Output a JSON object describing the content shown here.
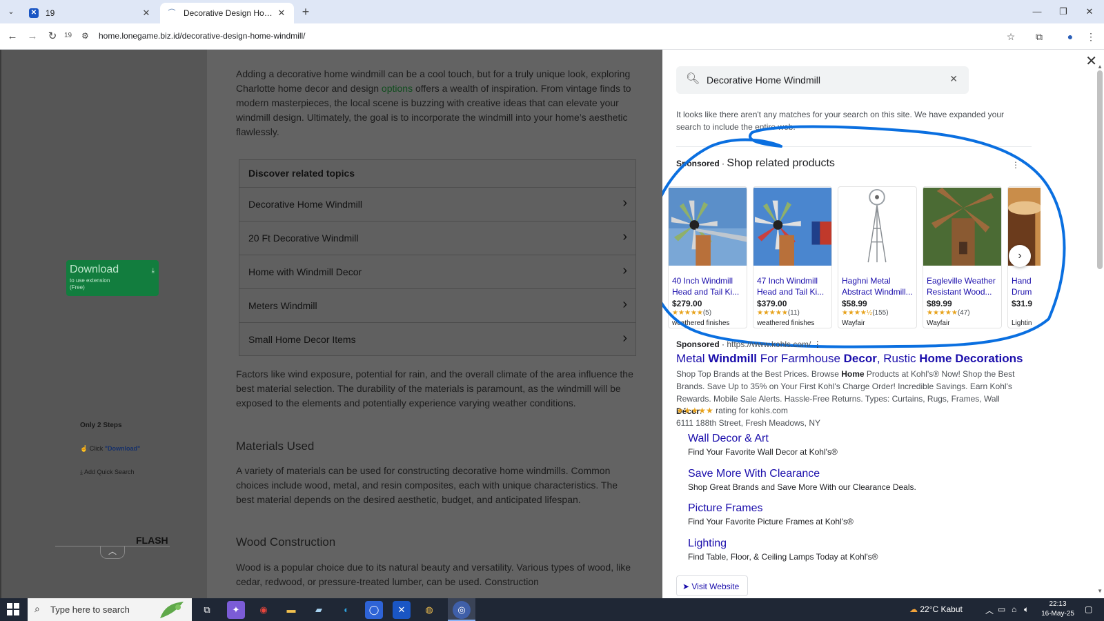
{
  "browser": {
    "tabs": [
      {
        "title": "19",
        "active": false
      },
      {
        "title": "Decorative Design Home Windmill",
        "active": true
      }
    ],
    "nav_count": "19",
    "url": "home.lonegame.biz.id/decorative-design-home-windmill/"
  },
  "sidebar": {
    "download": {
      "label": "Download",
      "sub1": "to use extension",
      "sub2": "(Free)"
    },
    "steps_title": "Only 2 Steps",
    "step1_prefix": "Click ",
    "step1_link": "\"Download\"",
    "step2": "Add Quick Search",
    "flash": "FLASH"
  },
  "article": {
    "intro_before": "Adding a decorative home windmill can be a cool touch, but for a truly unique look, exploring Charlotte home decor and design ",
    "intro_link": "options",
    "intro_after": " offers a wealth of inspiration. From vintage finds to modern masterpieces, the local scene is buzzing with creative ideas that can elevate your windmill design. Ultimately, the goal is to incorporate the windmill into your home’s aesthetic flawlessly.",
    "topics_heading": "Discover related topics",
    "topics": [
      "Decorative Home Windmill",
      "20 Ft Decorative Windmill",
      "Home with Windmill Decor",
      "Meters Windmill",
      "Small Home Decor Items"
    ],
    "para2": "Factors like wind exposure, potential for rain, and the overall climate of the area influence the best material selection. The durability of the materials is paramount, as the windmill will be exposed to the elements and potentially experience varying weather conditions.",
    "h_materials": "Materials Used",
    "para3": "A variety of materials can be used for constructing decorative home windmills. Common choices include wood, metal, and resin composites, each with unique characteristics. The best material depends on the desired aesthetic, budget, and anticipated lifespan.",
    "h_wood": "Wood Construction",
    "para4": "Wood is a popular choice due to its natural beauty and versatility. Various types of wood, like cedar, redwood, or pressure-treated lumber, can be used. Construction"
  },
  "search_panel": {
    "query": "Decorative Home Windmill",
    "no_match": "It looks like there aren't any matches for your search on this site. We have expanded your search to include the entire web.",
    "sponsored_label": "Sponsored",
    "shop_title": "Shop related products",
    "products": [
      {
        "name1": "40 Inch Windmill",
        "name2": "Head and Tail Ki...",
        "price": "$279.00",
        "stars": "★★★★★",
        "reviews": "(5)",
        "store": "weathered finishes"
      },
      {
        "name1": "47 Inch Windmill",
        "name2": "Head and Tail Ki...",
        "price": "$379.00",
        "stars": "★★★★★",
        "reviews": "(11)",
        "store": "weathered finishes"
      },
      {
        "name1": "Haghni Metal",
        "name2": "Abstract Windmill...",
        "price": "$58.99",
        "stars": "★★★★½",
        "reviews": "(155)",
        "store": "Wayfair"
      },
      {
        "name1": "Eagleville Weather",
        "name2": "Resistant Wood...",
        "price": "$89.99",
        "stars": "★★★★★",
        "reviews": "(47)",
        "store": "Wayfair"
      },
      {
        "name1": "Hand",
        "name2": "Drum",
        "price": "$31.9",
        "stars": "",
        "reviews": "",
        "store": "Lightin"
      }
    ],
    "ad": {
      "sponsored": "Sponsored",
      "url": "https://www.kohls.com/",
      "title_1": "Metal ",
      "title_2": "Windmill",
      "title_3": " For Farmhouse ",
      "title_4": "Decor",
      "title_5": ", Rustic ",
      "title_6": "Home Decorations",
      "desc_1": "Shop Top Brands at the Best Prices. Browse ",
      "desc_2": "Home",
      "desc_3": " Products at Kohl's® Now! Shop the Best Brands. Save Up to 35% on Your First Kohl's Charge Order! Incredible Savings. Earn Kohl's Rewards. Mobile Sale Alerts. Hassle-Free Returns. Types: Curtains, Rugs, Frames, Wall ",
      "desc_4": "Décor",
      "desc_5": ".",
      "rating_stars": "★★★★★",
      "rating_text": "rating for kohls.com",
      "address": "6111 188th Street, Fresh Meadows, NY",
      "sitelinks": [
        {
          "title": "Wall Decor & Art",
          "desc": "Find Your Favorite Wall Decor at Kohl's®"
        },
        {
          "title": "Save More With Clearance",
          "desc": "Shop Great Brands and Save More With our Clearance Deals."
        },
        {
          "title": "Picture Frames",
          "desc": "Find Your Favorite Picture Frames at Kohl's®"
        },
        {
          "title": "Lighting",
          "desc": "Find Table, Floor, & Ceiling Lamps Today at Kohl's®"
        }
      ],
      "visit": "➤ Visit Website"
    },
    "annotation_color": "#0a6fe0"
  },
  "taskbar": {
    "search_placeholder": "Type here to search",
    "weather": "22°C  Kabut",
    "time": "22:13",
    "date": "16-May-25"
  }
}
